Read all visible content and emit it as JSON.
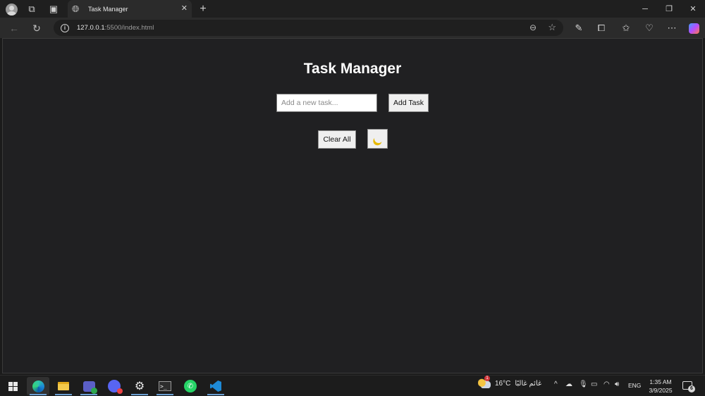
{
  "browser": {
    "tab_title": "Task Manager",
    "url_host": "127.0.0.1",
    "url_rest": ":5500/index.html"
  },
  "app": {
    "title": "Task Manager",
    "input_placeholder": "Add a new task...",
    "input_value": "",
    "add_button_label": "Add Task",
    "clear_button_label": "Clear All",
    "theme_toggle_icon": "moon-icon",
    "tasks": []
  },
  "taskbar": {
    "weather_temp": "16°C",
    "weather_condition": "غائم غالبًا",
    "weather_badge": "1",
    "language": "ENG",
    "time": "1:35 AM",
    "date": "3/9/2025",
    "notification_count": "6",
    "pinned_apps": [
      "start-button",
      "edge",
      "file-explorer",
      "teams",
      "discord",
      "settings",
      "terminal",
      "whatsapp",
      "vscode"
    ]
  },
  "colors": {
    "page_bg": "#202022",
    "chrome_bg": "#2b2b2b",
    "taskbar_bg": "#1c1c1c",
    "title_text": "#ffffff"
  }
}
